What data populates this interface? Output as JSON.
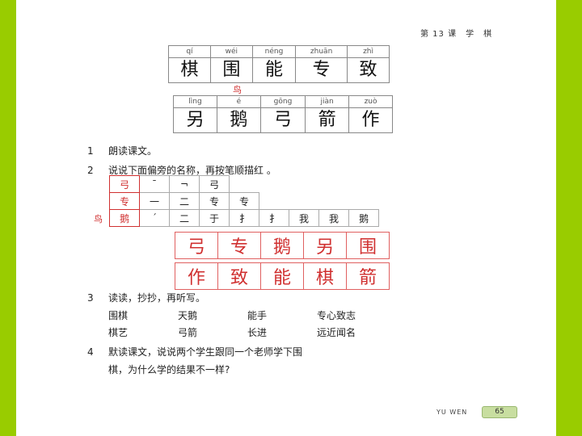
{
  "header": "第 13 课　学　棋",
  "grid1": [
    {
      "py": "qí",
      "ch": "棋"
    },
    {
      "py": "wéi",
      "ch": "围"
    },
    {
      "py": "néng",
      "ch": "能"
    },
    {
      "py": "zhuān",
      "ch": "专"
    },
    {
      "py": "zhì",
      "ch": "致"
    }
  ],
  "radical_note": "鸟",
  "grid2": [
    {
      "py": "lìng",
      "ch": "另"
    },
    {
      "py": "é",
      "ch": "鹅"
    },
    {
      "py": "gōng",
      "ch": "弓"
    },
    {
      "py": "jiàn",
      "ch": "箭"
    },
    {
      "py": "zuò",
      "ch": "作"
    }
  ],
  "q1": {
    "num": "1",
    "text": "朗读课文。"
  },
  "q2": {
    "num": "2",
    "text": "说说下面偏旁的名称，再按笔顺描红 。"
  },
  "strokes": {
    "row1": [
      "弓",
      "ˉ",
      "¬",
      "弓"
    ],
    "row2": [
      "专",
      "一",
      "二",
      "专",
      "专"
    ],
    "row3_label": "鸟",
    "row3": [
      "鹅",
      "ˊ",
      "二",
      "于",
      "扌",
      "扌",
      "我",
      "我",
      "鹅"
    ]
  },
  "trace1": [
    "弓",
    "专",
    "鹅",
    "另",
    "围"
  ],
  "trace2": [
    "作",
    "致",
    "能",
    "棋",
    "箭"
  ],
  "q3": {
    "num": "3",
    "text": "读读，抄抄，再听写。"
  },
  "words1": [
    "围棋",
    "天鹅",
    "能手",
    "专心致志"
  ],
  "words2": [
    "棋艺",
    "弓箭",
    "长进",
    "远近闻名"
  ],
  "q4": {
    "num": "4",
    "text": "默读课文，说说两个学生跟同一个老师学下围",
    "text2": "棋，为什么学的结果不一样?"
  },
  "footer": {
    "label": "YU WEN",
    "page": "65"
  }
}
